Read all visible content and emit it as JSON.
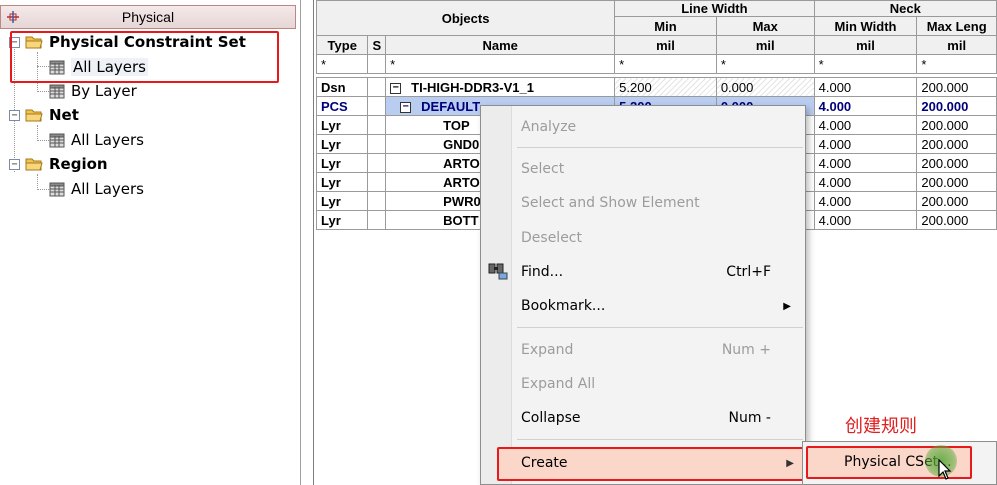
{
  "left_panel": {
    "header": "Physical",
    "tree": [
      {
        "label": "Physical Constraint Set",
        "level": 0
      },
      {
        "label": "All Layers",
        "level": 1
      },
      {
        "label": "By Layer",
        "level": 1
      },
      {
        "label": "Net",
        "level": 0
      },
      {
        "label": "All Layers",
        "level": 1
      },
      {
        "label": "Region",
        "level": 0
      },
      {
        "label": "All Layers",
        "level": 1
      }
    ]
  },
  "grid": {
    "headers": {
      "objects": "Objects",
      "line_width": "Line Width",
      "neck": "Neck",
      "type": "Type",
      "s": "S",
      "name": "Name",
      "min": "Min",
      "max": "Max",
      "min_width": "Min Width",
      "max_length": "Max Leng",
      "unit_min": "mil",
      "unit_max": "mil",
      "unit_min_width": "mil",
      "unit_max_length": "mil"
    },
    "filter_row": {
      "type": "*",
      "name": "*",
      "min": "*",
      "max": "*",
      "min_width": "*",
      "max_length": "*"
    },
    "rows": [
      {
        "type": "Dsn",
        "name": "TI-HIGH-DDR3-V1_1",
        "min": "5.200",
        "max": "0.000",
        "min_width": "4.000",
        "max_length": "200.000"
      },
      {
        "type": "PCS",
        "name": "DEFAULT",
        "min": "5.200",
        "max": "0.000",
        "min_width": "4.000",
        "max_length": "200.000"
      },
      {
        "type": "Lyr",
        "name": "TOP",
        "min": "",
        "max": "",
        "min_width": "4.000",
        "max_length": "200.000"
      },
      {
        "type": "Lyr",
        "name": "GND0",
        "min": "",
        "max": "",
        "min_width": "4.000",
        "max_length": "200.000"
      },
      {
        "type": "Lyr",
        "name": "ARTO",
        "min": "",
        "max": "",
        "min_width": "4.000",
        "max_length": "200.000"
      },
      {
        "type": "Lyr",
        "name": "ARTO",
        "min": "",
        "max": "",
        "min_width": "4.000",
        "max_length": "200.000"
      },
      {
        "type": "Lyr",
        "name": "PWR0",
        "min": "",
        "max": "",
        "min_width": "4.000",
        "max_length": "200.000"
      },
      {
        "type": "Lyr",
        "name": "BOTT",
        "min": "",
        "max": "",
        "min_width": "4.000",
        "max_length": "200.000"
      }
    ]
  },
  "context_menu": {
    "items": {
      "analyze": "Analyze",
      "select": "Select",
      "select_show": "Select and Show Element",
      "deselect": "Deselect",
      "find": "Find...",
      "find_shortcut": "Ctrl+F",
      "bookmark": "Bookmark...",
      "expand": "Expand",
      "expand_shortcut": "Num +",
      "expand_all": "Expand All",
      "collapse": "Collapse",
      "collapse_shortcut": "Num -",
      "create": "Create"
    },
    "submenu": {
      "physical_cset": "Physical CSet..."
    }
  },
  "annotation": {
    "note": "创建规则"
  },
  "colors": {
    "highlight_border": "#e8191a",
    "highlight_fill": "#fbd7c9",
    "note": "#e02020"
  }
}
